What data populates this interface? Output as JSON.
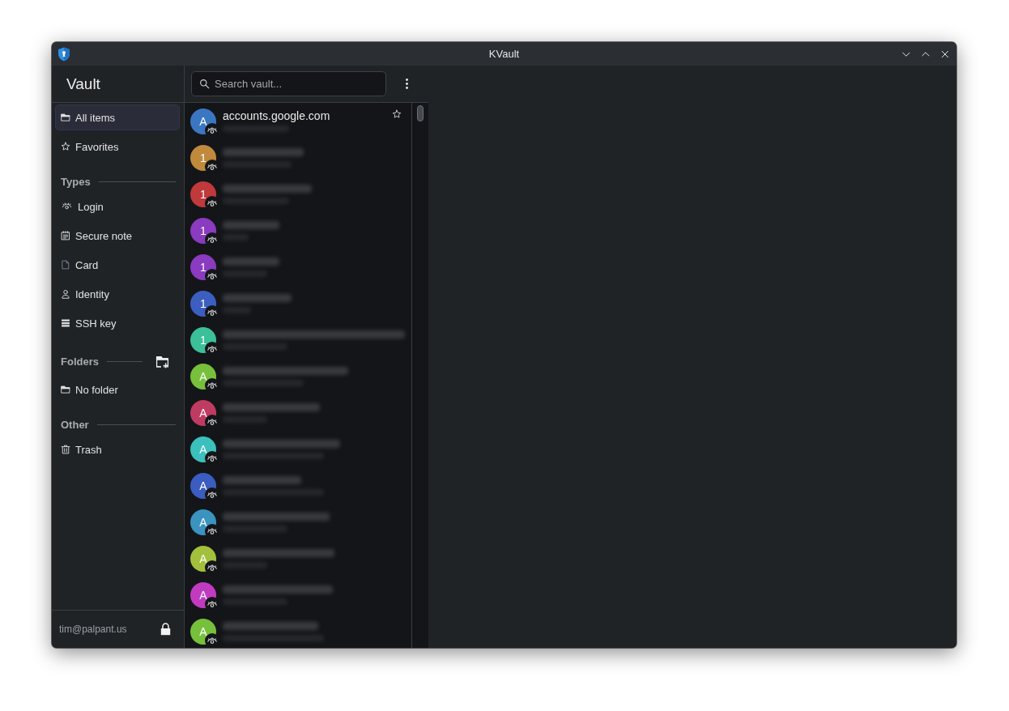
{
  "window": {
    "title": "KVault"
  },
  "sidebar": {
    "title": "Vault",
    "nav": [
      {
        "kind": "all",
        "label": "All items",
        "selected": true
      },
      {
        "kind": "favorites",
        "label": "Favorites",
        "selected": false
      }
    ],
    "sections": [
      {
        "heading": "Types",
        "items": [
          {
            "kind": "login",
            "label": "Login",
            "selected": false
          },
          {
            "kind": "note",
            "label": "Secure note",
            "selected": false
          },
          {
            "kind": "card",
            "label": "Card",
            "selected": false
          },
          {
            "kind": "identity",
            "label": "Identity",
            "selected": false
          },
          {
            "kind": "ssh",
            "label": "SSH key",
            "selected": false
          }
        ]
      },
      {
        "heading": "Folders",
        "add_button": true,
        "items": [
          {
            "kind": "folder",
            "label": "No folder",
            "selected": false
          }
        ]
      },
      {
        "heading": "Other",
        "items": [
          {
            "kind": "trash",
            "label": "Trash",
            "selected": false
          }
        ]
      }
    ],
    "footer": {
      "account": "tim@palpant.us"
    }
  },
  "list": {
    "search": {
      "placeholder": "Search vault..."
    },
    "rows": [
      {
        "avatar": "A",
        "color": "#3a77c0",
        "title": "accounts.google.com",
        "hovered": true
      },
      {
        "avatar": "1",
        "color": "#c0893b",
        "hovered": false
      },
      {
        "avatar": "1",
        "color": "#c0393b",
        "hovered": false
      },
      {
        "avatar": "1",
        "color": "#8a3bc0",
        "hovered": false
      },
      {
        "avatar": "1",
        "color": "#8a3bc0",
        "hovered": false
      },
      {
        "avatar": "1",
        "color": "#3b5ec0",
        "hovered": false
      },
      {
        "avatar": "1",
        "color": "#3bc09a",
        "hovered": false
      },
      {
        "avatar": "A",
        "color": "#77c03b",
        "hovered": false
      },
      {
        "avatar": "A",
        "color": "#c03b62",
        "hovered": false
      },
      {
        "avatar": "A",
        "color": "#3bc0bd",
        "hovered": false
      },
      {
        "avatar": "A",
        "color": "#3b5cc0",
        "hovered": false
      },
      {
        "avatar": "A",
        "color": "#3b93c0",
        "hovered": false
      },
      {
        "avatar": "A",
        "color": "#a2c03b",
        "hovered": false
      },
      {
        "avatar": "A",
        "color": "#c03bc0",
        "hovered": false
      },
      {
        "avatar": "A",
        "color": "#77c03b",
        "hovered": false
      }
    ]
  }
}
